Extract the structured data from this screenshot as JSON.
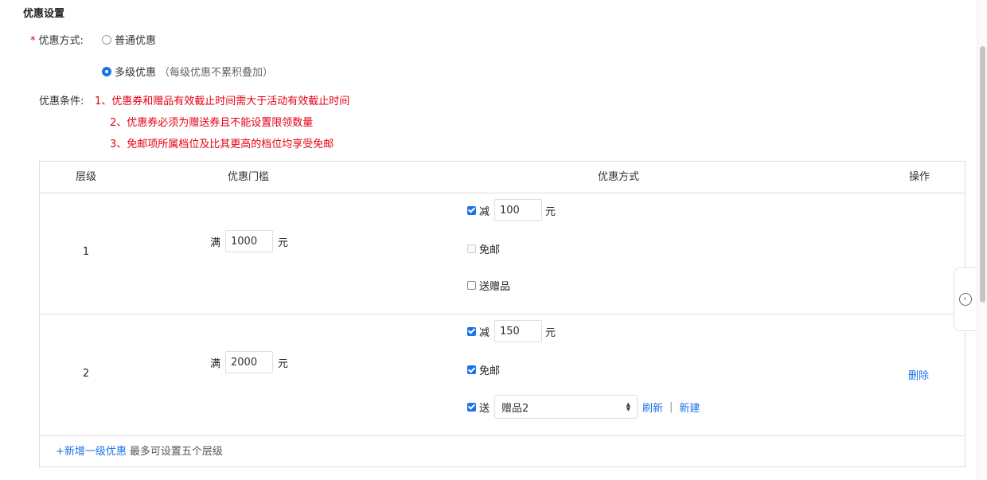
{
  "section": {
    "title": "优惠设置"
  },
  "method": {
    "label": "优惠方式:",
    "required_mark": "*",
    "options": [
      {
        "label": "普通优惠",
        "hint": "",
        "selected": false
      },
      {
        "label": "多级优惠",
        "hint": "（每级优惠不累积叠加）",
        "selected": true
      }
    ]
  },
  "conditions": {
    "label": "优惠条件:",
    "lines": [
      "1、优惠券和赠品有效截止时间需大于活动有效截止时间",
      "2、优惠券必须为赠送券且不能设置限领数量",
      "3、免邮项所属档位及比其更高的档位均享受免邮"
    ],
    "color": "#e60012"
  },
  "table": {
    "headers": {
      "level": "层级",
      "threshold": "优惠门槛",
      "method": "优惠方式",
      "action": "操作"
    },
    "rows": [
      {
        "level": "1",
        "threshold_prefix": "满",
        "threshold_value": "1000",
        "threshold_unit": "元",
        "discount": {
          "checked": true,
          "label": "减",
          "value": "100",
          "unit": "元"
        },
        "free_shipping": {
          "checked": false,
          "label": "免邮"
        },
        "gift": {
          "checked": false,
          "label": "送赠品"
        }
      },
      {
        "level": "2",
        "threshold_prefix": "满",
        "threshold_value": "2000",
        "threshold_unit": "元",
        "discount": {
          "checked": true,
          "label": "减",
          "value": "150",
          "unit": "元"
        },
        "free_shipping": {
          "checked": true,
          "label": "免邮"
        },
        "gift": {
          "checked": true,
          "label": "送",
          "selected": "赠品2",
          "refresh": "刷新",
          "separator": "|",
          "new": "新建"
        },
        "action": "删除"
      }
    ],
    "add_link": "+新增一级优惠",
    "add_note": "最多可设置五个层级"
  },
  "colors": {
    "accent": "#1a73e8",
    "required": "#e60012"
  },
  "icons": {
    "collapse": "chevron-left-circle-icon"
  }
}
